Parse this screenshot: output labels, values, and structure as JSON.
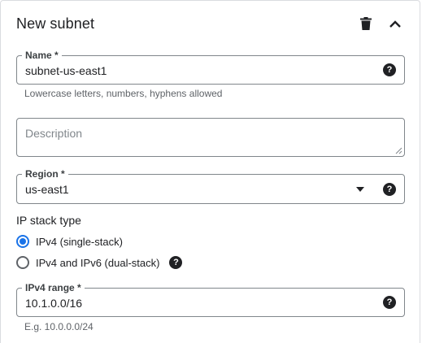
{
  "header": {
    "title": "New subnet",
    "trash_icon": "trash-icon",
    "collapse_icon": "chevron-up-icon"
  },
  "name_field": {
    "label": "Name *",
    "value": "subnet-us-east1",
    "help_icon": "?",
    "hint": "Lowercase letters, numbers, hyphens allowed"
  },
  "description_field": {
    "placeholder": "Description",
    "value": ""
  },
  "region_field": {
    "label": "Region *",
    "value": "us-east1",
    "help_icon": "?"
  },
  "ip_stack": {
    "title": "IP stack type",
    "options": [
      {
        "label": "IPv4 (single-stack)",
        "selected": true
      },
      {
        "label": "IPv4 and IPv6 (dual-stack)",
        "selected": false,
        "help_icon": "?"
      }
    ]
  },
  "ipv4_range_field": {
    "label": "IPv4 range *",
    "value": "10.1.0.0/16",
    "help_icon": "?",
    "hint": "E.g. 10.0.0.0/24"
  },
  "colors": {
    "accent": "#1a73e8",
    "border": "#80868b",
    "text": "#202124",
    "hint": "#5f6368"
  }
}
